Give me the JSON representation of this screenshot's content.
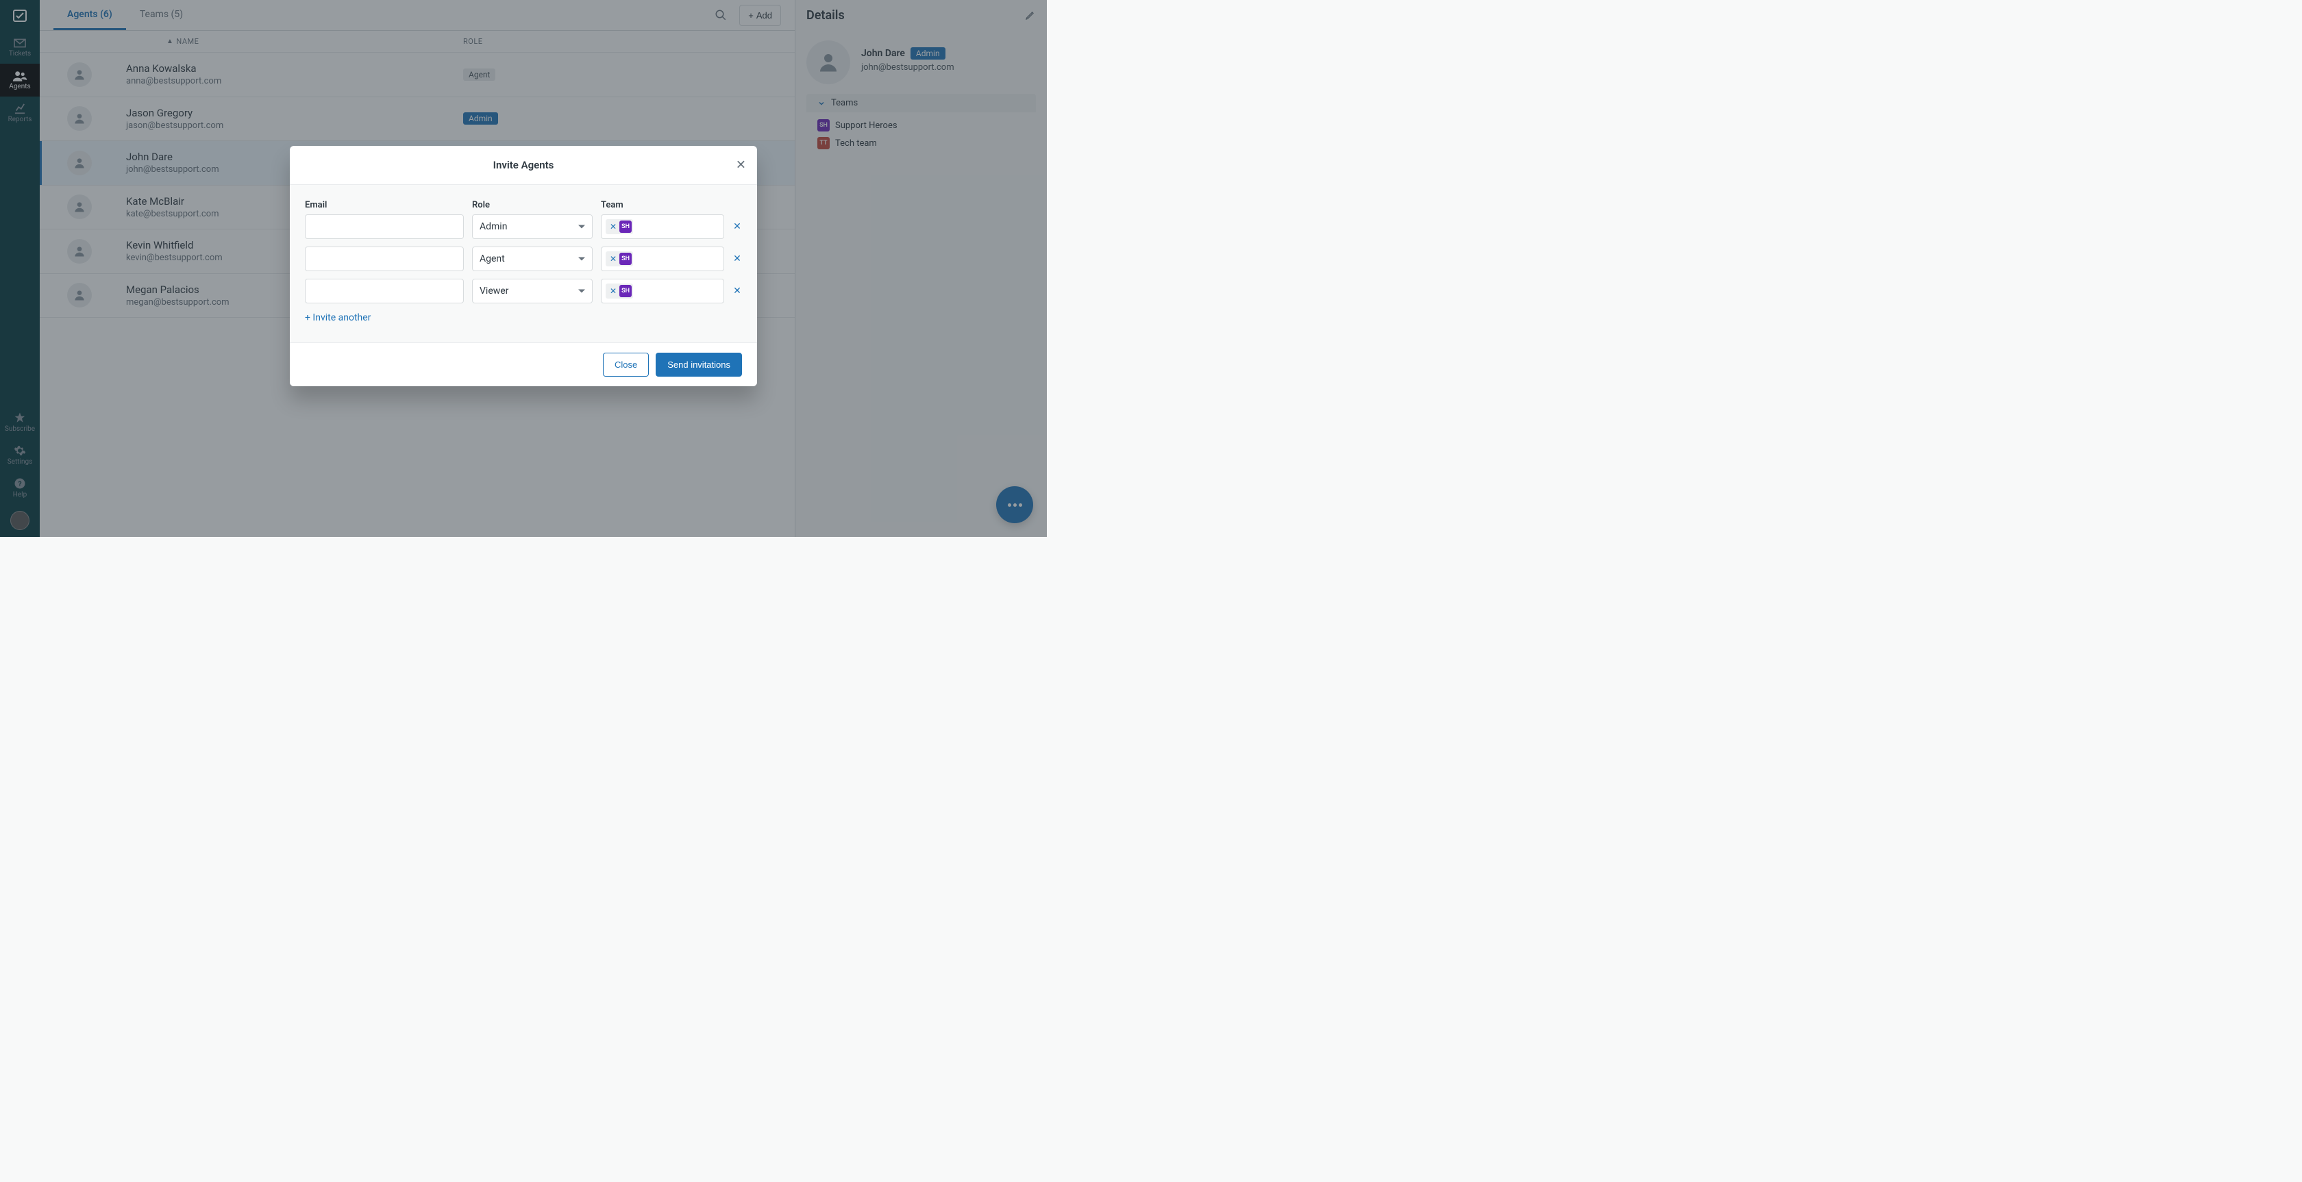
{
  "sidebar": {
    "items": [
      {
        "label": "Tickets"
      },
      {
        "label": "Agents"
      },
      {
        "label": "Reports"
      }
    ],
    "bottom": [
      {
        "label": "Subscribe"
      },
      {
        "label": "Settings"
      },
      {
        "label": "Help"
      }
    ]
  },
  "tabs": {
    "agents": {
      "label": "Agents",
      "count": "(6)"
    },
    "teams": {
      "label": "Teams",
      "count": "(5)"
    },
    "add_button": "Add"
  },
  "table": {
    "header_name": "Name",
    "header_role": "Role",
    "rows": [
      {
        "name": "Anna Kowalska",
        "email": "anna@bestsupport.com",
        "role": "Agent",
        "role_style": "agent"
      },
      {
        "name": "Jason Gregory",
        "email": "jason@bestsupport.com",
        "role": "Admin",
        "role_style": "admin"
      },
      {
        "name": "John Dare",
        "email": "john@bestsupport.com",
        "role": "",
        "role_style": ""
      },
      {
        "name": "Kate McBlair",
        "email": "kate@bestsupport.com",
        "role": "",
        "role_style": ""
      },
      {
        "name": "Kevin Whitfield",
        "email": "kevin@bestsupport.com",
        "role": "",
        "role_style": ""
      },
      {
        "name": "Megan Palacios",
        "email": "megan@bestsupport.com",
        "role": "",
        "role_style": ""
      }
    ]
  },
  "details": {
    "title": "Details",
    "user_name": "John Dare",
    "user_role": "Admin",
    "user_email": "john@bestsupport.com",
    "teams_label": "Teams",
    "teams": [
      {
        "badge": "SH",
        "label": "Support Heroes",
        "color": "#6a27b8"
      },
      {
        "badge": "TT",
        "label": "Tech team",
        "color": "#c2473a"
      }
    ]
  },
  "modal": {
    "title": "Invite Agents",
    "label_email": "Email",
    "label_role": "Role",
    "label_team": "Team",
    "rows": [
      {
        "email": "",
        "role": "Admin",
        "team_badge": "SH"
      },
      {
        "email": "",
        "role": "Agent",
        "team_badge": "SH"
      },
      {
        "email": "",
        "role": "Viewer",
        "team_badge": "SH"
      }
    ],
    "invite_another": "+ Invite another",
    "close_button": "Close",
    "send_button": "Send invitations"
  }
}
